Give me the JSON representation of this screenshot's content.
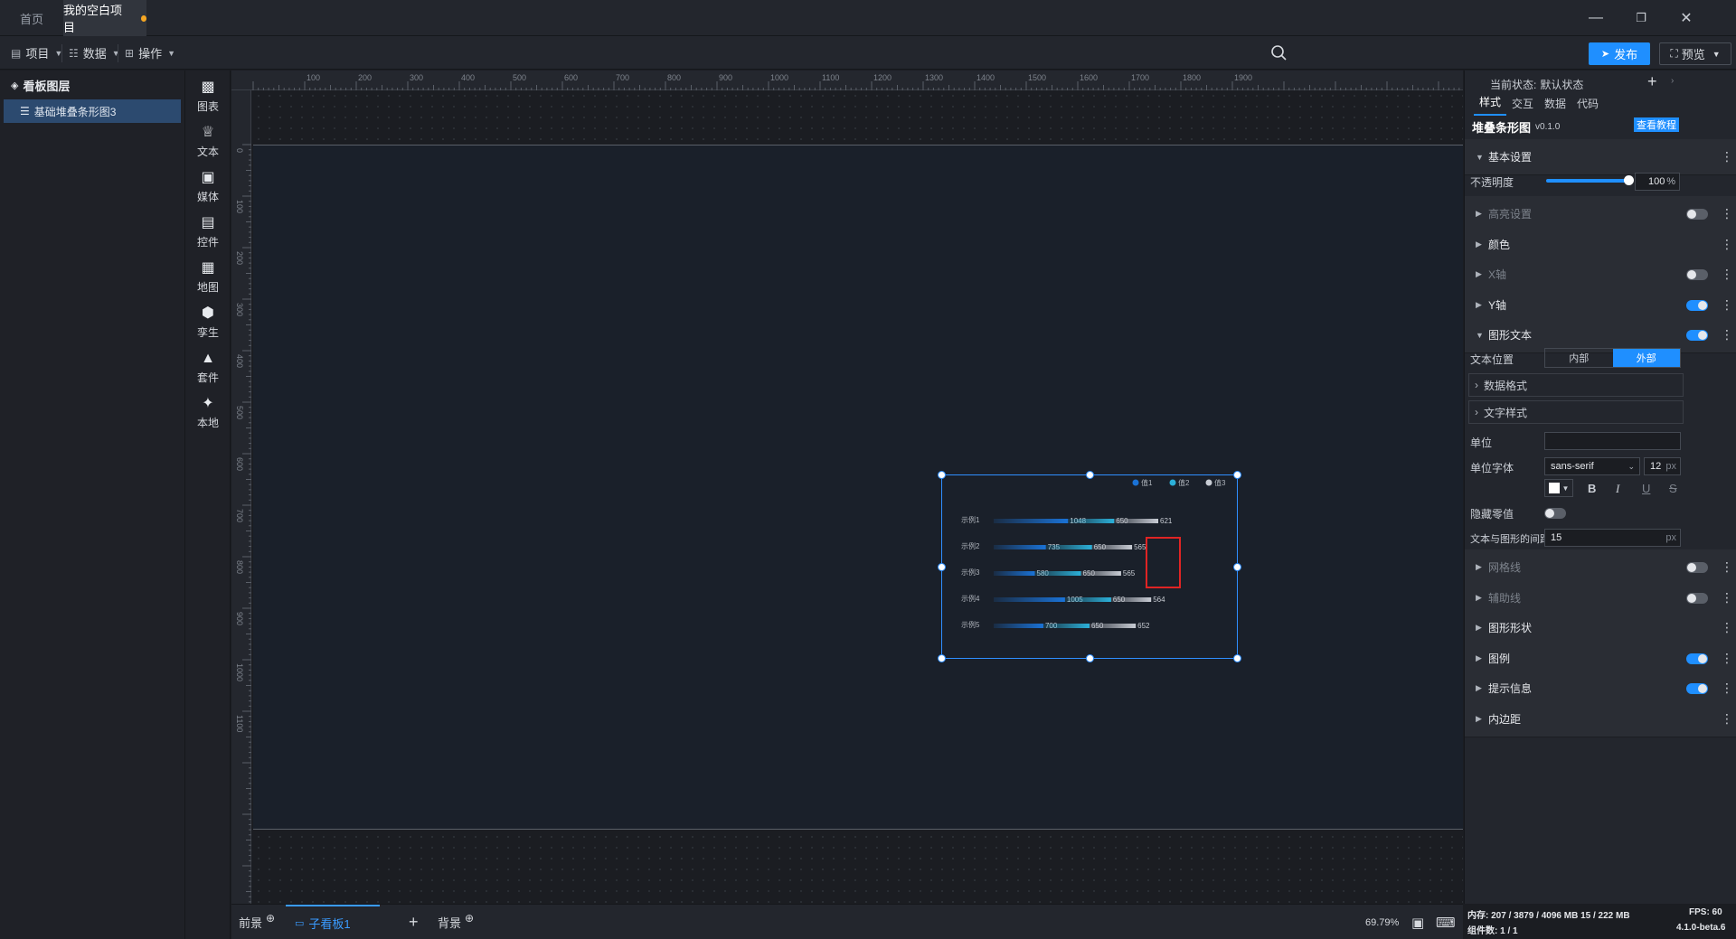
{
  "tabs": [
    {
      "label": "首页"
    },
    {
      "label": "我的空白项目"
    }
  ],
  "toolbar": {
    "project": "项目",
    "data": "数据",
    "operate": "操作",
    "publish": "发布",
    "preview": "预览"
  },
  "layers": {
    "title": "看板图层",
    "items": [
      {
        "label": "基础堆叠条形图3"
      }
    ]
  },
  "components": [
    {
      "label": "图表",
      "icon": "bar-chart-icon"
    },
    {
      "label": "文本",
      "icon": "crown-icon"
    },
    {
      "label": "媒体",
      "icon": "briefcase-icon"
    },
    {
      "label": "控件",
      "icon": "table-icon"
    },
    {
      "label": "地图",
      "icon": "map-icon"
    },
    {
      "label": "孪生",
      "icon": "cube-icon"
    },
    {
      "label": "套件",
      "icon": "shirt-icon"
    },
    {
      "label": "本地",
      "icon": "puzzle-icon"
    }
  ],
  "ruler": {
    "x": [
      "100",
      "200",
      "300",
      "400",
      "500",
      "600",
      "700",
      "800",
      "900",
      "1000",
      "1100",
      "1200",
      "1300",
      "1400",
      "1500",
      "1600",
      "1700",
      "1800",
      "1900"
    ],
    "y": [
      "0",
      "100",
      "200",
      "300",
      "400",
      "500",
      "600",
      "700",
      "800",
      "900",
      "1000",
      "1100"
    ]
  },
  "chart_data": {
    "type": "bar",
    "orientation": "horizontal",
    "stacked": true,
    "categories": [
      "示例1",
      "示例2",
      "示例3",
      "示例4",
      "示例5"
    ],
    "series": [
      {
        "name": "值1",
        "values": [
          1048,
          735,
          580,
          1005,
          700
        ]
      },
      {
        "name": "值2",
        "values": [
          650,
          650,
          650,
          650,
          650
        ]
      },
      {
        "name": "值3",
        "values": [
          621,
          565,
          565,
          564,
          652
        ]
      }
    ],
    "legend": "top-right"
  },
  "bottom": {
    "front": "前景",
    "board": "子看板1",
    "back": "背景",
    "zoom": "69.79%"
  },
  "panel": {
    "state_label": "当前状态:",
    "state_value": "默认状态",
    "tabs": [
      "样式",
      "交互",
      "数据",
      "代码"
    ],
    "component_name": "堆叠条形图",
    "version": "v0.1.0",
    "tutorial": "查看教程",
    "basic": "基本设置",
    "opacity_label": "不透明度",
    "opacity_value": "100",
    "opacity_unit": "%",
    "opacity_level": 1.0,
    "highlight": "高亮设置",
    "color": "颜色",
    "xaxis": "X轴",
    "yaxis": "Y轴",
    "shape_text": "图形文本",
    "text_pos_label": "文本位置",
    "text_pos_inner": "内部",
    "text_pos_outer": "外部",
    "data_format": "数据格式",
    "text_style": "文字样式",
    "unit_label": "单位",
    "unit_font_label": "单位字体",
    "font_value": "sans-serif",
    "font_size": "12",
    "px": "px",
    "bold": "B",
    "italic": "I",
    "underline": "U",
    "strike": "S",
    "hide_zero": "隐藏零值",
    "gap_label": "文本与图形的间距",
    "gap_value": "15",
    "grid": "网格线",
    "guide": "辅助线",
    "shape": "图形形状",
    "legend": "图例",
    "tooltip": "提示信息",
    "padding": "内边距"
  },
  "status": {
    "memory": "内存: 207 / 3879 / 4096 MB  15 / 222 MB",
    "fps": "FPS: 60",
    "count": "组件数: 1 / 1",
    "version": "4.1.0-beta.6"
  },
  "colors": {
    "accent": "#1f8fff",
    "series1": "#1a72d6",
    "series2": "#2bb0d9",
    "series3": "#c8ccd4"
  }
}
